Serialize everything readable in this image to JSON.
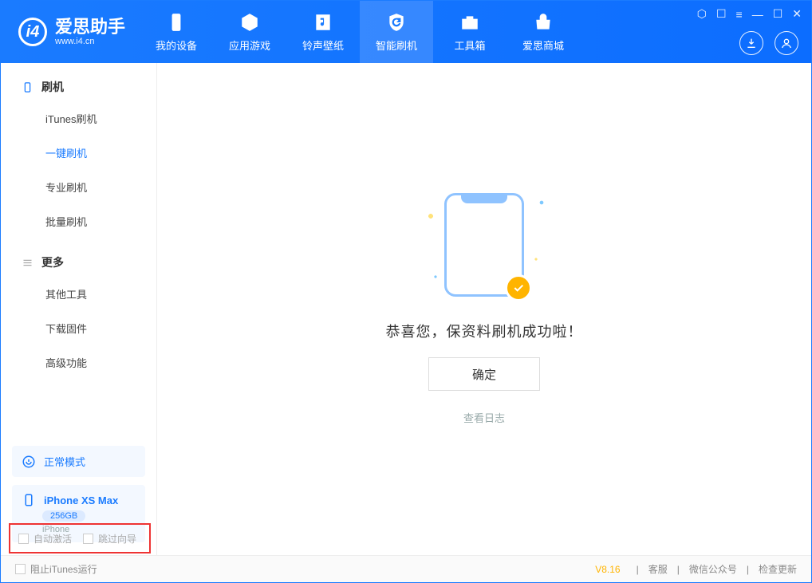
{
  "app": {
    "name": "爱思助手",
    "site": "www.i4.cn"
  },
  "titlebar": {
    "t1": "⬡",
    "t2": "☐",
    "t3": "≡",
    "min": "—",
    "max": "☐",
    "close": "✕"
  },
  "tabs": {
    "device": "我的设备",
    "apps": "应用游戏",
    "rings": "铃声壁纸",
    "flash": "智能刷机",
    "toolbox": "工具箱",
    "store": "爱思商城"
  },
  "sidebar": {
    "group_flash": "刷机",
    "items_flash": {
      "itunes": "iTunes刷机",
      "oneclick": "一键刷机",
      "pro": "专业刷机",
      "batch": "批量刷机"
    },
    "group_more": "更多",
    "items_more": {
      "other": "其他工具",
      "firmware": "下载固件",
      "advanced": "高级功能"
    }
  },
  "mode": {
    "label": "正常模式"
  },
  "device": {
    "name": "iPhone XS Max",
    "storage": "256GB",
    "type": "iPhone"
  },
  "options": {
    "auto_activate": "自动激活",
    "skip_guide": "跳过向导"
  },
  "main": {
    "msg": "恭喜您，保资料刷机成功啦！",
    "ok": "确定",
    "log": "查看日志"
  },
  "footer": {
    "block_itunes": "阻止iTunes运行",
    "version": "V8.16",
    "support": "客服",
    "wechat": "微信公众号",
    "update": "检查更新"
  }
}
